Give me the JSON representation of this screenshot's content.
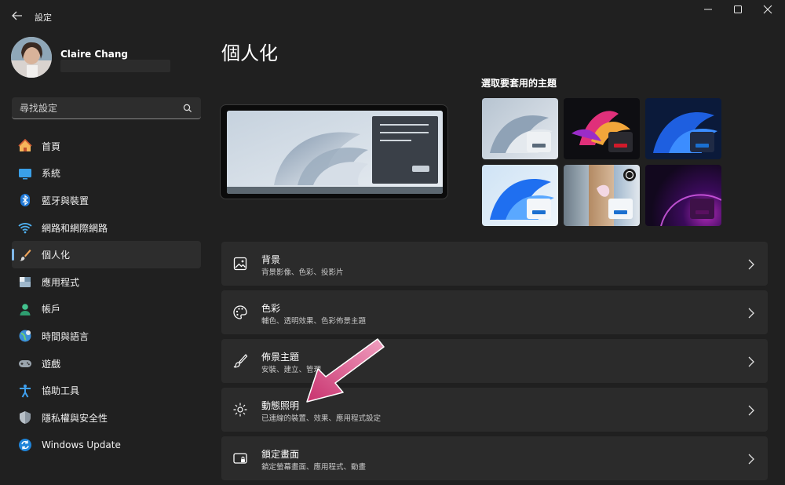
{
  "window": {
    "title": "設定",
    "back_icon": "back-arrow-icon",
    "minimize_icon": "minimize-icon",
    "maximize_icon": "maximize-icon",
    "close_icon": "close-icon"
  },
  "user": {
    "name": "Claire Chang"
  },
  "search": {
    "placeholder": "尋找設定"
  },
  "sidebar": {
    "items": [
      {
        "label": "首頁",
        "icon": "home-icon"
      },
      {
        "label": "系統",
        "icon": "system-icon"
      },
      {
        "label": "藍牙與裝置",
        "icon": "bluetooth-icon"
      },
      {
        "label": "網路和網際網路",
        "icon": "wifi-icon"
      },
      {
        "label": "個人化",
        "icon": "brush-icon",
        "active": true
      },
      {
        "label": "應用程式",
        "icon": "apps-icon"
      },
      {
        "label": "帳戶",
        "icon": "account-icon"
      },
      {
        "label": "時間與語言",
        "icon": "globe-icon"
      },
      {
        "label": "遊戲",
        "icon": "gamepad-icon"
      },
      {
        "label": "協助工具",
        "icon": "accessibility-icon"
      },
      {
        "label": "隱私權與安全性",
        "icon": "shield-icon"
      },
      {
        "label": "Windows Update",
        "icon": "windows-update-icon"
      }
    ]
  },
  "main": {
    "title": "個人化",
    "theme_section_label": "選取要套用的主題",
    "themes": [
      {
        "name": "light-bloom",
        "accent": "#5a6a7a"
      },
      {
        "name": "glow",
        "accent": "#d11a2a"
      },
      {
        "name": "dark-bloom",
        "accent": "#1a6fd0"
      },
      {
        "name": "light-windows",
        "accent": "#1a6fd0"
      },
      {
        "name": "captured-motion",
        "accent": "#1a6fd0"
      },
      {
        "name": "flow",
        "accent": "#5a1060"
      }
    ],
    "cards": [
      {
        "title": "背景",
        "subtitle": "背景影像、色彩、投影片",
        "icon": "image-icon"
      },
      {
        "title": "色彩",
        "subtitle": "輔色、透明效果、色彩佈景主題",
        "icon": "palette-icon"
      },
      {
        "title": "佈景主題",
        "subtitle": "安裝、建立、管理",
        "icon": "brush-icon"
      },
      {
        "title": "動態照明",
        "subtitle": "已連線的裝置、效果、應用程式設定",
        "icon": "lighting-icon"
      },
      {
        "title": "鎖定畫面",
        "subtitle": "鎖定螢幕畫面、應用程式、動畫",
        "icon": "lock-screen-icon"
      }
    ]
  },
  "colors": {
    "background": "#202020",
    "card": "#2b2b2b",
    "accent": "#7fb7e8",
    "annotation_arrow": "#d6487a"
  }
}
